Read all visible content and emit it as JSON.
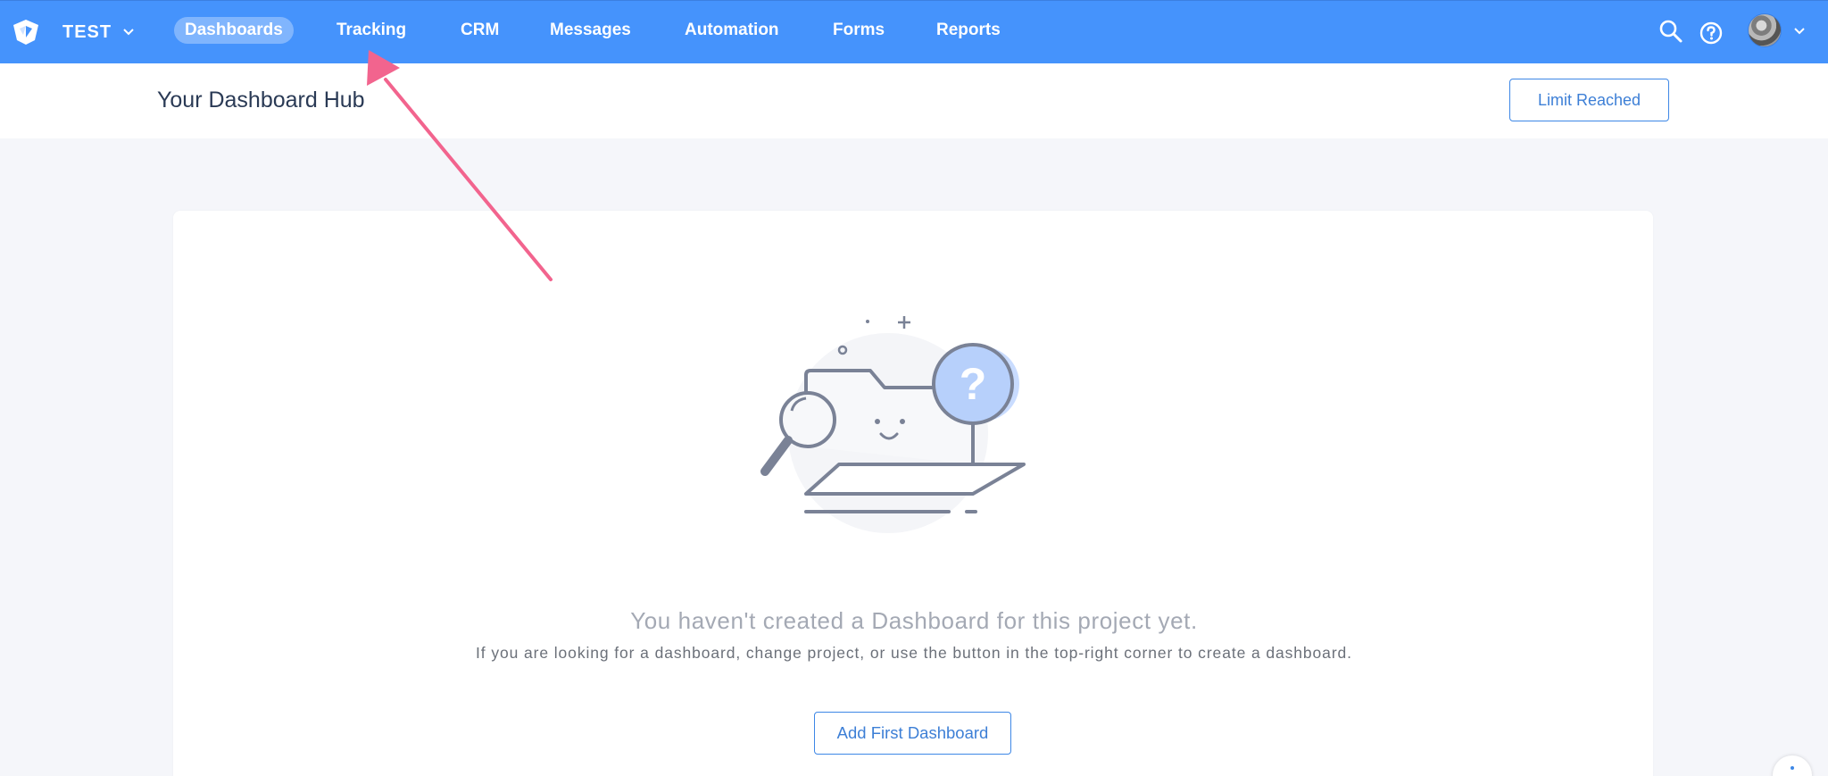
{
  "app": {
    "project_name": "TEST",
    "accent_color": "#4593fc"
  },
  "nav": {
    "items": [
      {
        "label": "Dashboards",
        "active": true
      },
      {
        "label": "Tracking",
        "active": false
      },
      {
        "label": "CRM",
        "active": false
      },
      {
        "label": "Messages",
        "active": false
      },
      {
        "label": "Automation",
        "active": false
      },
      {
        "label": "Forms",
        "active": false
      },
      {
        "label": "Reports",
        "active": false
      }
    ],
    "icons": [
      "logo-icon",
      "search-icon",
      "help-icon",
      "avatar",
      "chevron-down-icon"
    ]
  },
  "header": {
    "title": "Your Dashboard Hub",
    "limit_button": "Limit Reached"
  },
  "empty_state": {
    "title": "You haven't created a Dashboard for this project yet.",
    "description": "If you are looking for a dashboard, change project, or use the button in the top-right corner to create a dashboard.",
    "button": "Add First Dashboard",
    "illustration": "empty-folder-question-illustration"
  },
  "annotation": {
    "arrow_color": "#f2648e",
    "points_to": "Tracking"
  }
}
